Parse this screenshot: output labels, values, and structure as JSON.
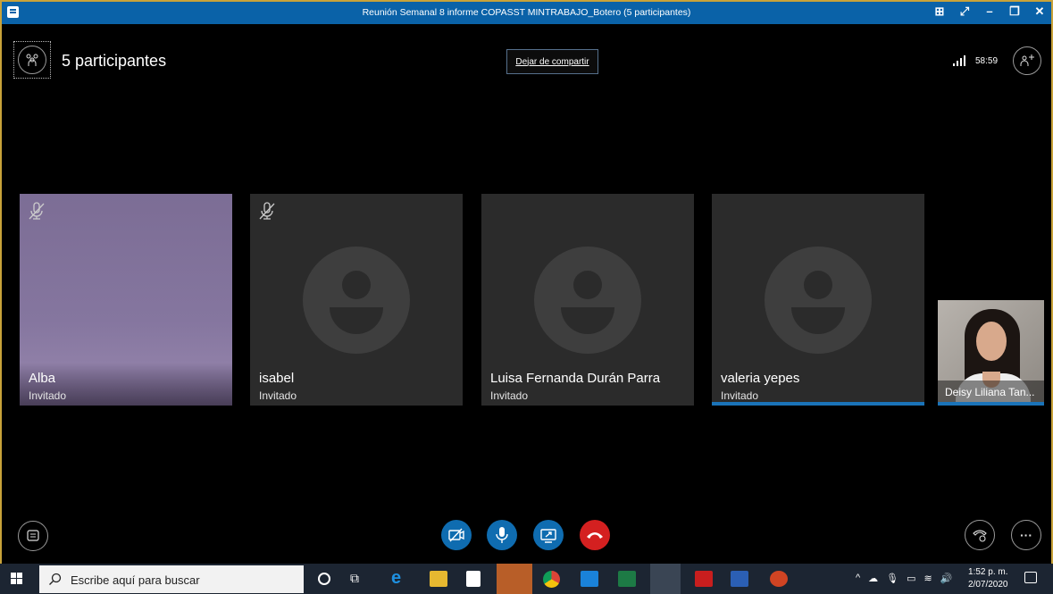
{
  "window": {
    "title": "Reunión Semanal 8 informe COPASST MINTRABAJO_Botero (5 participantes)"
  },
  "header": {
    "participants_label": "5 participantes",
    "stop_sharing": "Dejar de compartir",
    "timer": "58:59"
  },
  "participants": [
    {
      "name": "Alba",
      "role": "Invitado",
      "muted": true
    },
    {
      "name": "isabel",
      "role": "Invitado",
      "muted": true
    },
    {
      "name": "Luisa Fernanda Durán Parra",
      "role": "Invitado",
      "muted": false
    },
    {
      "name": "valeria yepes",
      "role": "Invitado",
      "muted": false,
      "speaking": true
    }
  ],
  "self_view": {
    "name": "Deisy Liliana Tan..."
  },
  "controls": [
    "video-off",
    "microphone",
    "share-screen",
    "hang-up"
  ],
  "taskbar": {
    "search_placeholder": "Escribe aquí para buscar",
    "time": "1:52 p. m.",
    "date": "2/07/2020"
  },
  "colors": {
    "accent": "#0f6cb0",
    "hangup": "#d42020",
    "titlebar": "#0a62a8",
    "frame": "#c8a23a"
  }
}
